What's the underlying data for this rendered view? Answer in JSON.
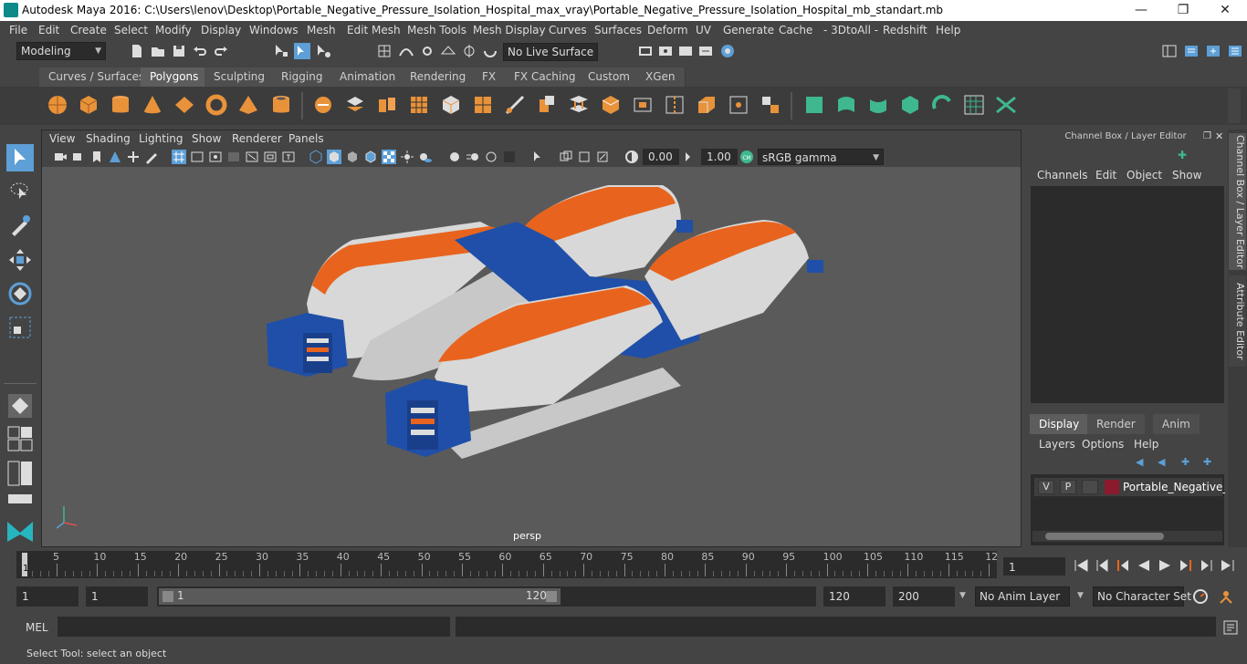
{
  "window": {
    "title": "Autodesk Maya 2016: C:\\Users\\lenov\\Desktop\\Portable_Negative_Pressure_Isolation_Hospital_max_vray\\Portable_Negative_Pressure_Isolation_Hospital_mb_standart.mb",
    "min": "—",
    "max": "❐",
    "close": "✕"
  },
  "menubar": [
    "File",
    "Edit",
    "Create",
    "Select",
    "Modify",
    "Display",
    "Windows",
    "Mesh",
    "Edit Mesh",
    "Mesh Tools",
    "Mesh Display",
    "Curves",
    "Surfaces",
    "Deform",
    "UV",
    "Generate",
    "Cache",
    "- 3DtoAll -",
    "Redshift",
    "Help"
  ],
  "status": {
    "mode": "Modeling",
    "live_surface": "No Live Surface"
  },
  "shelf_tabs": [
    "Curves / Surfaces",
    "Polygons",
    "Sculpting",
    "Rigging",
    "Animation",
    "Rendering",
    "FX",
    "FX Caching",
    "Custom",
    "XGen"
  ],
  "shelf_active": "Polygons",
  "viewport": {
    "menu": [
      "View",
      "Shading",
      "Lighting",
      "Show",
      "Renderer",
      "Panels"
    ],
    "exposure": "0.00",
    "gamma": "1.00",
    "color_space": "sRGB gamma",
    "camera": "persp"
  },
  "channel_box": {
    "title": "Channel Box / Layer Editor",
    "menu": [
      "Channels",
      "Edit",
      "Object",
      "Show"
    ],
    "layer_tabs": [
      "Display",
      "Render",
      "Anim"
    ],
    "layer_menu": [
      "Layers",
      "Options",
      "Help"
    ],
    "layer": {
      "v": "V",
      "p": "P",
      "name": "Portable_Negative_Pre",
      "color": "#8b1a2e"
    }
  },
  "side_tabs": [
    "Channel Box / Layer Editor",
    "Attribute Editor"
  ],
  "timeline": {
    "ticks": [
      "5",
      "10",
      "15",
      "20",
      "25",
      "30",
      "35",
      "40",
      "45",
      "50",
      "55",
      "60",
      "65",
      "70",
      "75",
      "80",
      "85",
      "90",
      "95",
      "100",
      "105",
      "110",
      "115",
      "12"
    ],
    "start_marker": "1",
    "current_frame": "1"
  },
  "range": {
    "start": "1",
    "anim_start": "1",
    "slider_start": "1",
    "slider_end": "120",
    "end": "120",
    "anim_end": "200",
    "anim_layer": "No Anim Layer",
    "char_set": "No Character Set"
  },
  "command": {
    "lang": "MEL"
  },
  "help_line": "Select Tool: select an object",
  "colors": {
    "accent": "#5d9fd6",
    "tent_orange": "#e8641e",
    "tent_white": "#d8d8d8",
    "module_blue": "#1f4fa8"
  }
}
